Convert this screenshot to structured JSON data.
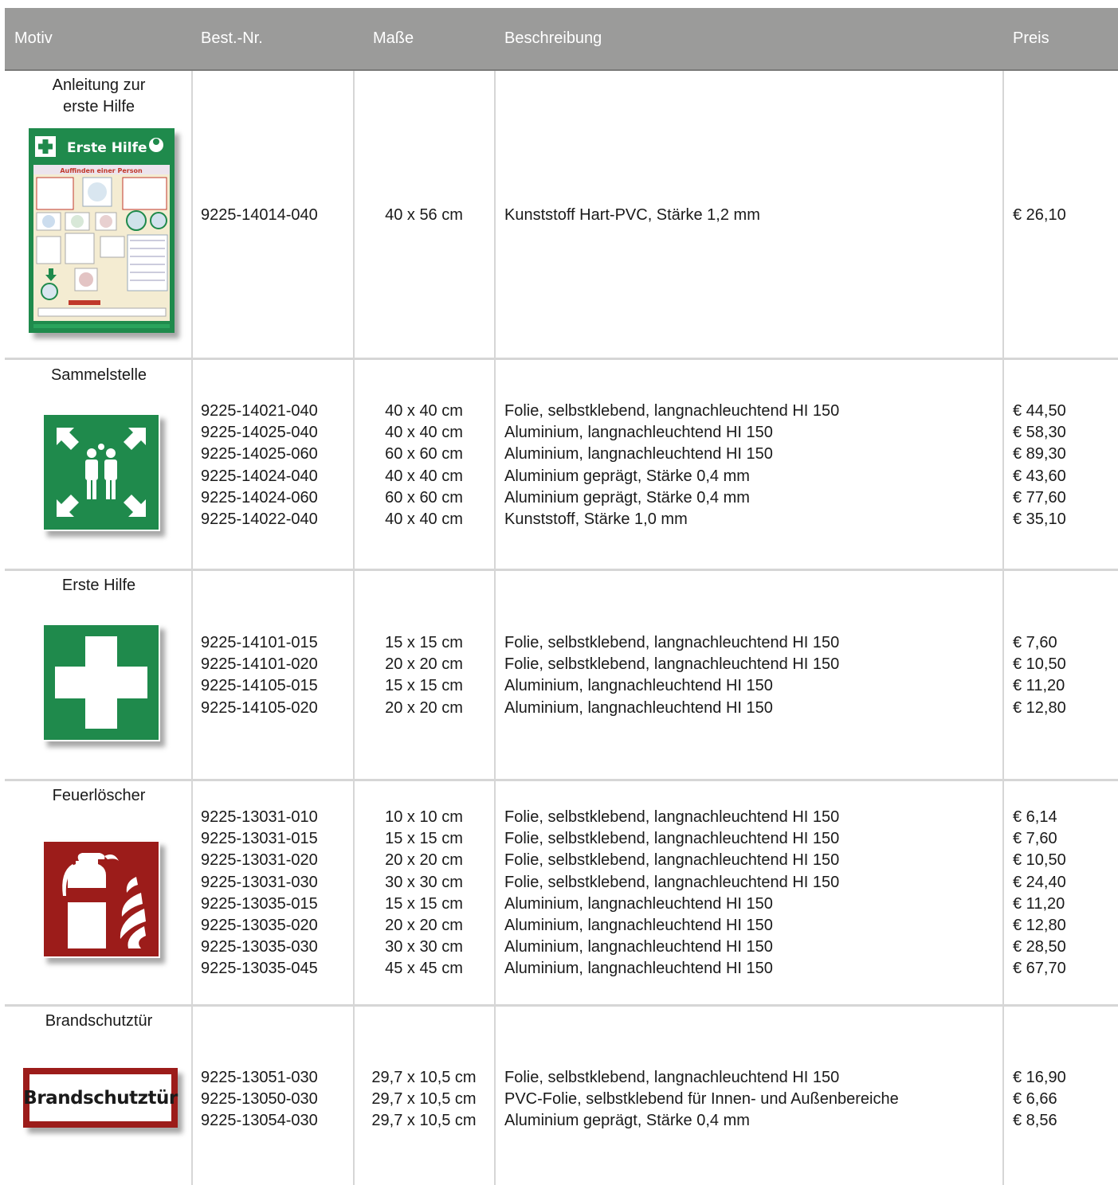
{
  "header": {
    "motiv": "Motiv",
    "bestnr": "Best.-Nr.",
    "masse": "Maße",
    "beschreibung": "Beschreibung",
    "preis": "Preis"
  },
  "rows": [
    {
      "motiv": "Anleitung zur erste Hilfe",
      "sign_icon": "first-aid-instruction-poster-icon",
      "poster": {
        "title": "Erste Hilfe",
        "subtitle": "Auffinden einer Person"
      },
      "items": [
        {
          "nr": "9225-14014-040",
          "mass": "40 x 56 cm",
          "desc": "Kunststoff Hart-PVC, Stärke 1,2 mm",
          "preis": "€ 26,10"
        }
      ]
    },
    {
      "motiv": "Sammelstelle",
      "sign_icon": "assembly-point-icon",
      "items": [
        {
          "nr": "9225-14021-040",
          "mass": "40 x 40 cm",
          "desc": "Folie, selbstklebend, langnachleuchtend HI 150",
          "preis": "€ 44,50"
        },
        {
          "nr": "9225-14025-040",
          "mass": "40 x 40 cm",
          "desc": "Aluminium, langnachleuchtend HI 150",
          "preis": "€ 58,30"
        },
        {
          "nr": "9225-14025-060",
          "mass": "60 x 60 cm",
          "desc": "Aluminium, langnachleuchtend HI 150",
          "preis": "€ 89,30"
        },
        {
          "nr": "9225-14024-040",
          "mass": "40 x 40 cm",
          "desc": "Aluminium geprägt, Stärke 0,4 mm",
          "preis": "€ 43,60"
        },
        {
          "nr": "9225-14024-060",
          "mass": "60 x 60 cm",
          "desc": "Aluminium geprägt, Stärke 0,4 mm",
          "preis": "€ 77,60"
        },
        {
          "nr": "9225-14022-040",
          "mass": "40 x 40 cm",
          "desc": "Kunststoff, Stärke 1,0 mm",
          "preis": "€ 35,10"
        }
      ]
    },
    {
      "motiv": "Erste Hilfe",
      "sign_icon": "first-aid-cross-icon",
      "items": [
        {
          "nr": "9225-14101-015",
          "mass": "15 x 15 cm",
          "desc": "Folie, selbstklebend, langnachleuchtend HI 150",
          "preis": "€ 7,60"
        },
        {
          "nr": "9225-14101-020",
          "mass": "20 x 20 cm",
          "desc": "Folie, selbstklebend, langnachleuchtend HI 150",
          "preis": "€ 10,50"
        },
        {
          "nr": "9225-14105-015",
          "mass": "15 x 15 cm",
          "desc": "Aluminium, langnachleuchtend HI 150",
          "preis": "€ 11,20"
        },
        {
          "nr": "9225-14105-020",
          "mass": "20 x 20 cm",
          "desc": "Aluminium, langnachleuchtend HI 150",
          "preis": "€ 12,80"
        }
      ]
    },
    {
      "motiv": "Feuerlöscher",
      "sign_icon": "fire-extinguisher-icon",
      "items": [
        {
          "nr": "9225-13031-010",
          "mass": "10 x 10 cm",
          "desc": "Folie, selbstklebend, langnachleuchtend HI 150",
          "preis": "€ 6,14"
        },
        {
          "nr": "9225-13031-015",
          "mass": "15 x 15 cm",
          "desc": "Folie, selbstklebend, langnachleuchtend HI 150",
          "preis": "€ 7,60"
        },
        {
          "nr": "9225-13031-020",
          "mass": "20 x 20 cm",
          "desc": "Folie, selbstklebend, langnachleuchtend HI 150",
          "preis": "€ 10,50"
        },
        {
          "nr": "9225-13031-030",
          "mass": "30 x 30 cm",
          "desc": "Folie, selbstklebend, langnachleuchtend HI 150",
          "preis": "€ 24,40"
        },
        {
          "nr": "9225-13035-015",
          "mass": "15 x 15 cm",
          "desc": "Aluminium, langnachleuchtend HI 150",
          "preis": "€ 11,20"
        },
        {
          "nr": "9225-13035-020",
          "mass": "20 x 20 cm",
          "desc": "Aluminium, langnachleuchtend HI 150",
          "preis": "€ 12,80"
        },
        {
          "nr": "9225-13035-030",
          "mass": "30 x 30 cm",
          "desc": "Aluminium, langnachleuchtend HI 150",
          "preis": "€ 28,50"
        },
        {
          "nr": "9225-13035-045",
          "mass": "45 x 45 cm",
          "desc": "Aluminium, langnachleuchtend HI 150",
          "preis": "€ 67,70"
        }
      ]
    },
    {
      "motiv": "Brandschutztür",
      "sign_icon": "fire-door-sign-icon",
      "sign_text": "Brandschutztür",
      "items": [
        {
          "nr": "9225-13051-030",
          "mass": "29,7 x 10,5 cm",
          "desc": "Folie, selbstklebend, langnachleuchtend HI 150",
          "preis": "€ 16,90"
        },
        {
          "nr": "9225-13050-030",
          "mass": "29,7 x 10,5 cm",
          "desc": "PVC-Folie, selbstklebend für Innen- und Außenbereiche",
          "preis": "€ 6,66"
        },
        {
          "nr": "9225-13054-030",
          "mass": "29,7 x 10,5 cm",
          "desc": "Aluminium geprägt, Stärke 0,4 mm",
          "preis": "€ 8,56"
        }
      ]
    }
  ],
  "colors": {
    "header_bg": "#9b9b9a",
    "safety_green": "#1f8a4c",
    "fire_red": "#9c1c1a",
    "grid_line": "#d6d6d6"
  }
}
